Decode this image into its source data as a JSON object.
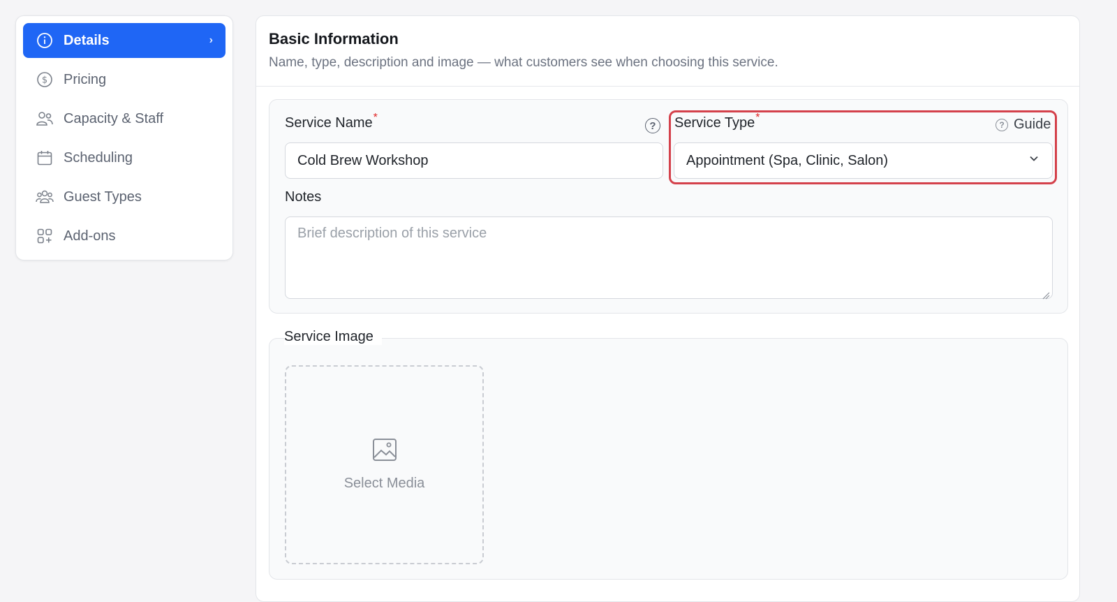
{
  "sidebar": {
    "items": [
      {
        "label": "Details",
        "icon": "info-icon",
        "active": true
      },
      {
        "label": "Pricing",
        "icon": "dollar-icon",
        "active": false
      },
      {
        "label": "Capacity & Staff",
        "icon": "users-icon",
        "active": false
      },
      {
        "label": "Scheduling",
        "icon": "calendar-icon",
        "active": false
      },
      {
        "label": "Guest Types",
        "icon": "group-icon",
        "active": false
      },
      {
        "label": "Add-ons",
        "icon": "grid-plus-icon",
        "active": false
      }
    ],
    "active_chevron": "›"
  },
  "main": {
    "title": "Basic Information",
    "subtitle": "Name, type, description and image — what customers see when choosing this service.",
    "service_name": {
      "label": "Service Name",
      "required_mark": "*",
      "value": "Cold Brew Workshop",
      "help": "?"
    },
    "service_type": {
      "label": "Service Type",
      "required_mark": "*",
      "guide_label": "Guide",
      "guide_help": "?",
      "selected": "Appointment (Spa, Clinic, Salon)"
    },
    "notes": {
      "label": "Notes",
      "placeholder": "Brief description of this service"
    },
    "service_image": {
      "legend": "Service Image",
      "select_label": "Select Media"
    }
  },
  "colors": {
    "accent": "#1f66f5",
    "highlight": "#d4414b",
    "required": "#e02424"
  }
}
